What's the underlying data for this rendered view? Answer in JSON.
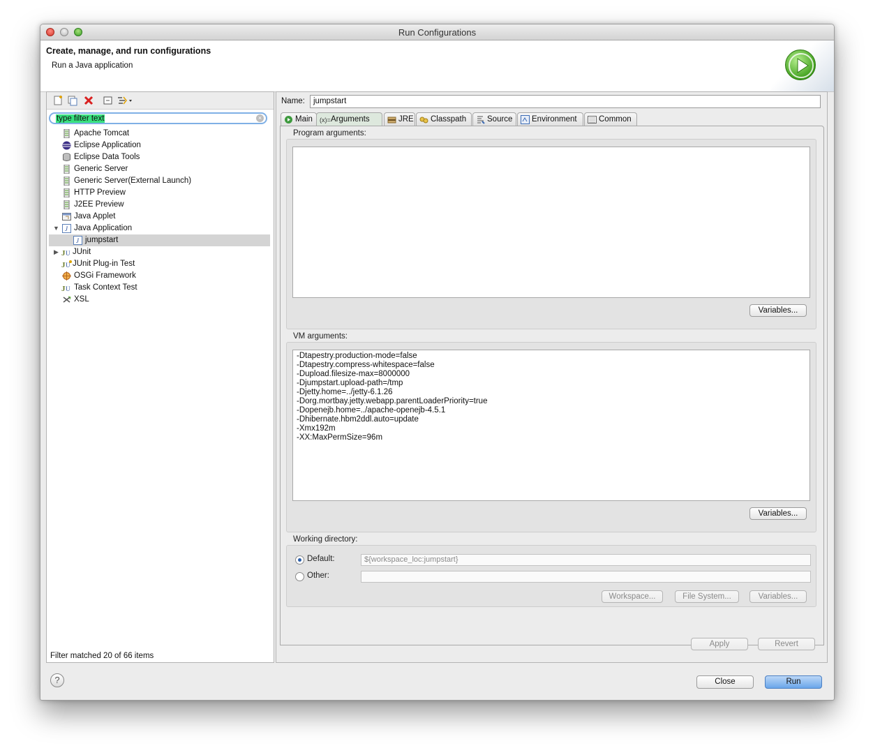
{
  "window": {
    "title": "Run Configurations"
  },
  "header": {
    "title": "Create, manage, and run configurations",
    "subtitle": "Run a Java application",
    "icon": "run-icon"
  },
  "left": {
    "toolbar": [
      {
        "name": "new-launch-configuration-icon"
      },
      {
        "name": "duplicate-icon"
      },
      {
        "name": "delete-icon"
      },
      {
        "name": "collapse-all-icon"
      },
      {
        "name": "filter-icon"
      }
    ],
    "filter_placeholder": "type filter text",
    "tree": [
      {
        "label": "Apache Tomcat",
        "icon": "server-icon",
        "indent": 1
      },
      {
        "label": "Eclipse Application",
        "icon": "eclipse-icon",
        "indent": 1
      },
      {
        "label": "Eclipse Data Tools",
        "icon": "database-icon",
        "indent": 1
      },
      {
        "label": "Generic Server",
        "icon": "server-icon",
        "indent": 1
      },
      {
        "label": "Generic Server(External Launch)",
        "icon": "server-icon",
        "indent": 1
      },
      {
        "label": "HTTP Preview",
        "icon": "server-icon",
        "indent": 1
      },
      {
        "label": "J2EE Preview",
        "icon": "server-icon",
        "indent": 1
      },
      {
        "label": "Java Applet",
        "icon": "applet-icon",
        "indent": 1
      },
      {
        "label": "Java Application",
        "icon": "java-app-icon",
        "indent": 1,
        "expanded": true
      },
      {
        "label": "jumpstart",
        "icon": "java-app-icon",
        "indent": 2,
        "selected": true
      },
      {
        "label": "JUnit",
        "icon": "junit-icon",
        "indent": 1,
        "collapsed": true
      },
      {
        "label": "JUnit Plug-in Test",
        "icon": "junit-plugin-icon",
        "indent": 1
      },
      {
        "label": "OSGi Framework",
        "icon": "osgi-icon",
        "indent": 1
      },
      {
        "label": "Task Context Test",
        "icon": "junit-icon",
        "indent": 1
      },
      {
        "label": "XSL",
        "icon": "xsl-icon",
        "indent": 1
      }
    ],
    "status": "Filter matched 20 of 66 items"
  },
  "right": {
    "name_label": "Name:",
    "name_value": "jumpstart",
    "tabs": [
      {
        "label": "Main",
        "icon": "main-tab-icon"
      },
      {
        "label": "Arguments",
        "icon": "arguments-tab-icon",
        "active": true
      },
      {
        "label": "JRE",
        "icon": "jre-tab-icon"
      },
      {
        "label": "Classpath",
        "icon": "classpath-tab-icon"
      },
      {
        "label": "Source",
        "icon": "source-tab-icon"
      },
      {
        "label": "Environment",
        "icon": "environment-tab-icon"
      },
      {
        "label": "Common",
        "icon": "common-tab-icon"
      }
    ],
    "program_args_label": "Program arguments:",
    "program_args_value": "",
    "variables_label": "Variables...",
    "vm_args_label": "VM arguments:",
    "vm_args": [
      "-Dtapestry.production-mode=false",
      "-Dtapestry.compress-whitespace=false",
      "-Dupload.filesize-max=8000000",
      "-Djumpstart.upload-path=/tmp",
      "-Djetty.home=../jetty-6.1.26",
      "-Dorg.mortbay.jetty.webapp.parentLoaderPriority=true",
      "-Dopenejb.home=../apache-openejb-4.5.1",
      "-Dhibernate.hbm2ddl.auto=update",
      "-Xmx192m",
      "-XX:MaxPermSize=96m"
    ],
    "working_dir_label": "Working directory:",
    "default_label": "Default:",
    "default_value": "${workspace_loc:jumpstart}",
    "other_label": "Other:",
    "other_value": "",
    "workspace_btn": "Workspace...",
    "filesystem_btn": "File System...",
    "variables_btn": "Variables...",
    "apply_btn": "Apply",
    "revert_btn": "Revert"
  },
  "footer": {
    "close_btn": "Close",
    "run_btn": "Run",
    "help": "?"
  }
}
